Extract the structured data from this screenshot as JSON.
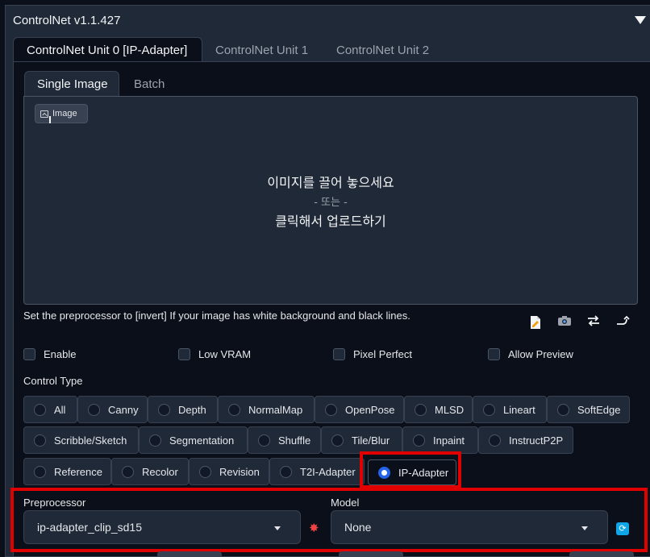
{
  "header": {
    "title": "ControlNet v1.1.427"
  },
  "unit_tabs": [
    {
      "label": "ControlNet Unit 0 [IP-Adapter]",
      "active": true
    },
    {
      "label": "ControlNet Unit 1",
      "active": false
    },
    {
      "label": "ControlNet Unit 2",
      "active": false
    }
  ],
  "image_tabs": [
    {
      "label": "Single Image",
      "active": true
    },
    {
      "label": "Batch",
      "active": false
    }
  ],
  "dropzone": {
    "badge_label": "Image",
    "line1": "이미지를 끌어 놓으세요",
    "line2": "- 또는 -",
    "line3": "클릭해서 업로드하기"
  },
  "hint_text": "Set the preprocessor to [invert] If your image has white background and black lines.",
  "tool_icons": [
    "new-canvas-icon",
    "camera-icon",
    "swap-icon",
    "send-dimensions-icon"
  ],
  "options": {
    "enable": "Enable",
    "low_vram": "Low VRAM",
    "pixel_perfect": "Pixel Perfect",
    "allow_preview": "Allow Preview"
  },
  "control_type": {
    "label": "Control Type",
    "selected": "IP-Adapter",
    "items": [
      "All",
      "Canny",
      "Depth",
      "NormalMap",
      "OpenPose",
      "MLSD",
      "Lineart",
      "SoftEdge",
      "Scribble/Sketch",
      "Segmentation",
      "Shuffle",
      "Tile/Blur",
      "Inpaint",
      "InstructP2P",
      "Reference",
      "Recolor",
      "Revision",
      "T2I-Adapter",
      "IP-Adapter"
    ]
  },
  "preprocessor": {
    "label": "Preprocessor",
    "value": "ip-adapter_clip_sd15"
  },
  "model": {
    "label": "Model",
    "value": "None"
  },
  "colors": {
    "accent": "#2563eb",
    "highlight": "#e00000",
    "background": "#0b0f19",
    "panel": "#1f2937"
  }
}
